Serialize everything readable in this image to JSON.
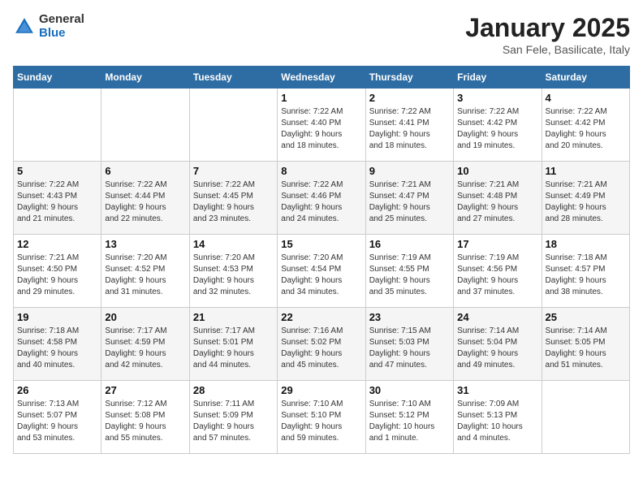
{
  "logo": {
    "general": "General",
    "blue": "Blue"
  },
  "title": "January 2025",
  "subtitle": "San Fele, Basilicate, Italy",
  "days_of_week": [
    "Sunday",
    "Monday",
    "Tuesday",
    "Wednesday",
    "Thursday",
    "Friday",
    "Saturday"
  ],
  "weeks": [
    [
      {
        "day": "",
        "detail": ""
      },
      {
        "day": "",
        "detail": ""
      },
      {
        "day": "",
        "detail": ""
      },
      {
        "day": "1",
        "detail": "Sunrise: 7:22 AM\nSunset: 4:40 PM\nDaylight: 9 hours\nand 18 minutes."
      },
      {
        "day": "2",
        "detail": "Sunrise: 7:22 AM\nSunset: 4:41 PM\nDaylight: 9 hours\nand 18 minutes."
      },
      {
        "day": "3",
        "detail": "Sunrise: 7:22 AM\nSunset: 4:42 PM\nDaylight: 9 hours\nand 19 minutes."
      },
      {
        "day": "4",
        "detail": "Sunrise: 7:22 AM\nSunset: 4:42 PM\nDaylight: 9 hours\nand 20 minutes."
      }
    ],
    [
      {
        "day": "5",
        "detail": "Sunrise: 7:22 AM\nSunset: 4:43 PM\nDaylight: 9 hours\nand 21 minutes."
      },
      {
        "day": "6",
        "detail": "Sunrise: 7:22 AM\nSunset: 4:44 PM\nDaylight: 9 hours\nand 22 minutes."
      },
      {
        "day": "7",
        "detail": "Sunrise: 7:22 AM\nSunset: 4:45 PM\nDaylight: 9 hours\nand 23 minutes."
      },
      {
        "day": "8",
        "detail": "Sunrise: 7:22 AM\nSunset: 4:46 PM\nDaylight: 9 hours\nand 24 minutes."
      },
      {
        "day": "9",
        "detail": "Sunrise: 7:21 AM\nSunset: 4:47 PM\nDaylight: 9 hours\nand 25 minutes."
      },
      {
        "day": "10",
        "detail": "Sunrise: 7:21 AM\nSunset: 4:48 PM\nDaylight: 9 hours\nand 27 minutes."
      },
      {
        "day": "11",
        "detail": "Sunrise: 7:21 AM\nSunset: 4:49 PM\nDaylight: 9 hours\nand 28 minutes."
      }
    ],
    [
      {
        "day": "12",
        "detail": "Sunrise: 7:21 AM\nSunset: 4:50 PM\nDaylight: 9 hours\nand 29 minutes."
      },
      {
        "day": "13",
        "detail": "Sunrise: 7:20 AM\nSunset: 4:52 PM\nDaylight: 9 hours\nand 31 minutes."
      },
      {
        "day": "14",
        "detail": "Sunrise: 7:20 AM\nSunset: 4:53 PM\nDaylight: 9 hours\nand 32 minutes."
      },
      {
        "day": "15",
        "detail": "Sunrise: 7:20 AM\nSunset: 4:54 PM\nDaylight: 9 hours\nand 34 minutes."
      },
      {
        "day": "16",
        "detail": "Sunrise: 7:19 AM\nSunset: 4:55 PM\nDaylight: 9 hours\nand 35 minutes."
      },
      {
        "day": "17",
        "detail": "Sunrise: 7:19 AM\nSunset: 4:56 PM\nDaylight: 9 hours\nand 37 minutes."
      },
      {
        "day": "18",
        "detail": "Sunrise: 7:18 AM\nSunset: 4:57 PM\nDaylight: 9 hours\nand 38 minutes."
      }
    ],
    [
      {
        "day": "19",
        "detail": "Sunrise: 7:18 AM\nSunset: 4:58 PM\nDaylight: 9 hours\nand 40 minutes."
      },
      {
        "day": "20",
        "detail": "Sunrise: 7:17 AM\nSunset: 4:59 PM\nDaylight: 9 hours\nand 42 minutes."
      },
      {
        "day": "21",
        "detail": "Sunrise: 7:17 AM\nSunset: 5:01 PM\nDaylight: 9 hours\nand 44 minutes."
      },
      {
        "day": "22",
        "detail": "Sunrise: 7:16 AM\nSunset: 5:02 PM\nDaylight: 9 hours\nand 45 minutes."
      },
      {
        "day": "23",
        "detail": "Sunrise: 7:15 AM\nSunset: 5:03 PM\nDaylight: 9 hours\nand 47 minutes."
      },
      {
        "day": "24",
        "detail": "Sunrise: 7:14 AM\nSunset: 5:04 PM\nDaylight: 9 hours\nand 49 minutes."
      },
      {
        "day": "25",
        "detail": "Sunrise: 7:14 AM\nSunset: 5:05 PM\nDaylight: 9 hours\nand 51 minutes."
      }
    ],
    [
      {
        "day": "26",
        "detail": "Sunrise: 7:13 AM\nSunset: 5:07 PM\nDaylight: 9 hours\nand 53 minutes."
      },
      {
        "day": "27",
        "detail": "Sunrise: 7:12 AM\nSunset: 5:08 PM\nDaylight: 9 hours\nand 55 minutes."
      },
      {
        "day": "28",
        "detail": "Sunrise: 7:11 AM\nSunset: 5:09 PM\nDaylight: 9 hours\nand 57 minutes."
      },
      {
        "day": "29",
        "detail": "Sunrise: 7:10 AM\nSunset: 5:10 PM\nDaylight: 9 hours\nand 59 minutes."
      },
      {
        "day": "30",
        "detail": "Sunrise: 7:10 AM\nSunset: 5:12 PM\nDaylight: 10 hours\nand 1 minute."
      },
      {
        "day": "31",
        "detail": "Sunrise: 7:09 AM\nSunset: 5:13 PM\nDaylight: 10 hours\nand 4 minutes."
      },
      {
        "day": "",
        "detail": ""
      }
    ]
  ]
}
